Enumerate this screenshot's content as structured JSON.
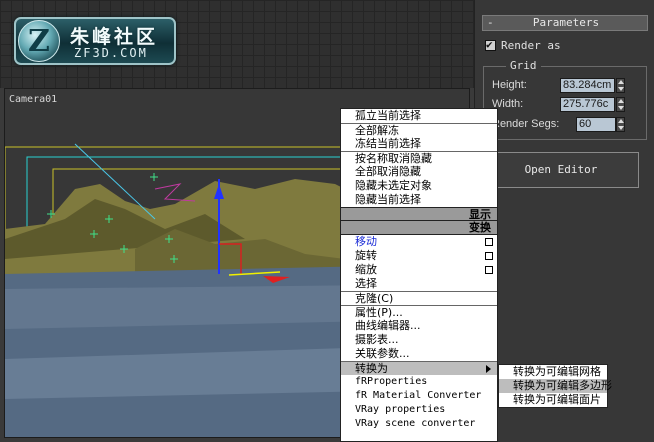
{
  "logo": {
    "icon_letter": "Z",
    "title_cn": "朱峰社区",
    "title_en": "ZF3D.COM"
  },
  "viewport": {
    "label": "Camera01"
  },
  "parameters": {
    "title": "Parameters",
    "render_as": "Render as",
    "render_as_checked": true,
    "grid_group": "Grid",
    "height_label": "Height:",
    "height_value": "83.284cm",
    "width_label": "Width:",
    "width_value": "275.776c",
    "segs_label": "Render Segs:",
    "segs_value": "60",
    "open_editor": "Open Editor"
  },
  "menu": {
    "display_items": [
      "孤立当前选择",
      "全部解冻",
      "冻结当前选择",
      "按名称取消隐藏",
      "全部取消隐藏",
      "隐藏未选定对象",
      "隐藏当前选择"
    ],
    "display_header": "显示",
    "transform_header": "变换",
    "transform_items": [
      "移动",
      "旋转",
      "缩放",
      "选择"
    ],
    "clone": "克隆(C)",
    "properties": "属性(P)...",
    "curve_editor": "曲线编辑器...",
    "dope_sheet": "摄影表...",
    "wire_params": "关联参数...",
    "convert_to": "转换为",
    "plugins": [
      "fRProperties",
      "fR Material Converter",
      "VRay properties",
      "VRay scene converter"
    ]
  },
  "submenu": {
    "items": [
      "转换为可编辑网格",
      "转换为可编辑多边形",
      "转换为可编辑面片"
    ],
    "highlighted_index": 1
  }
}
